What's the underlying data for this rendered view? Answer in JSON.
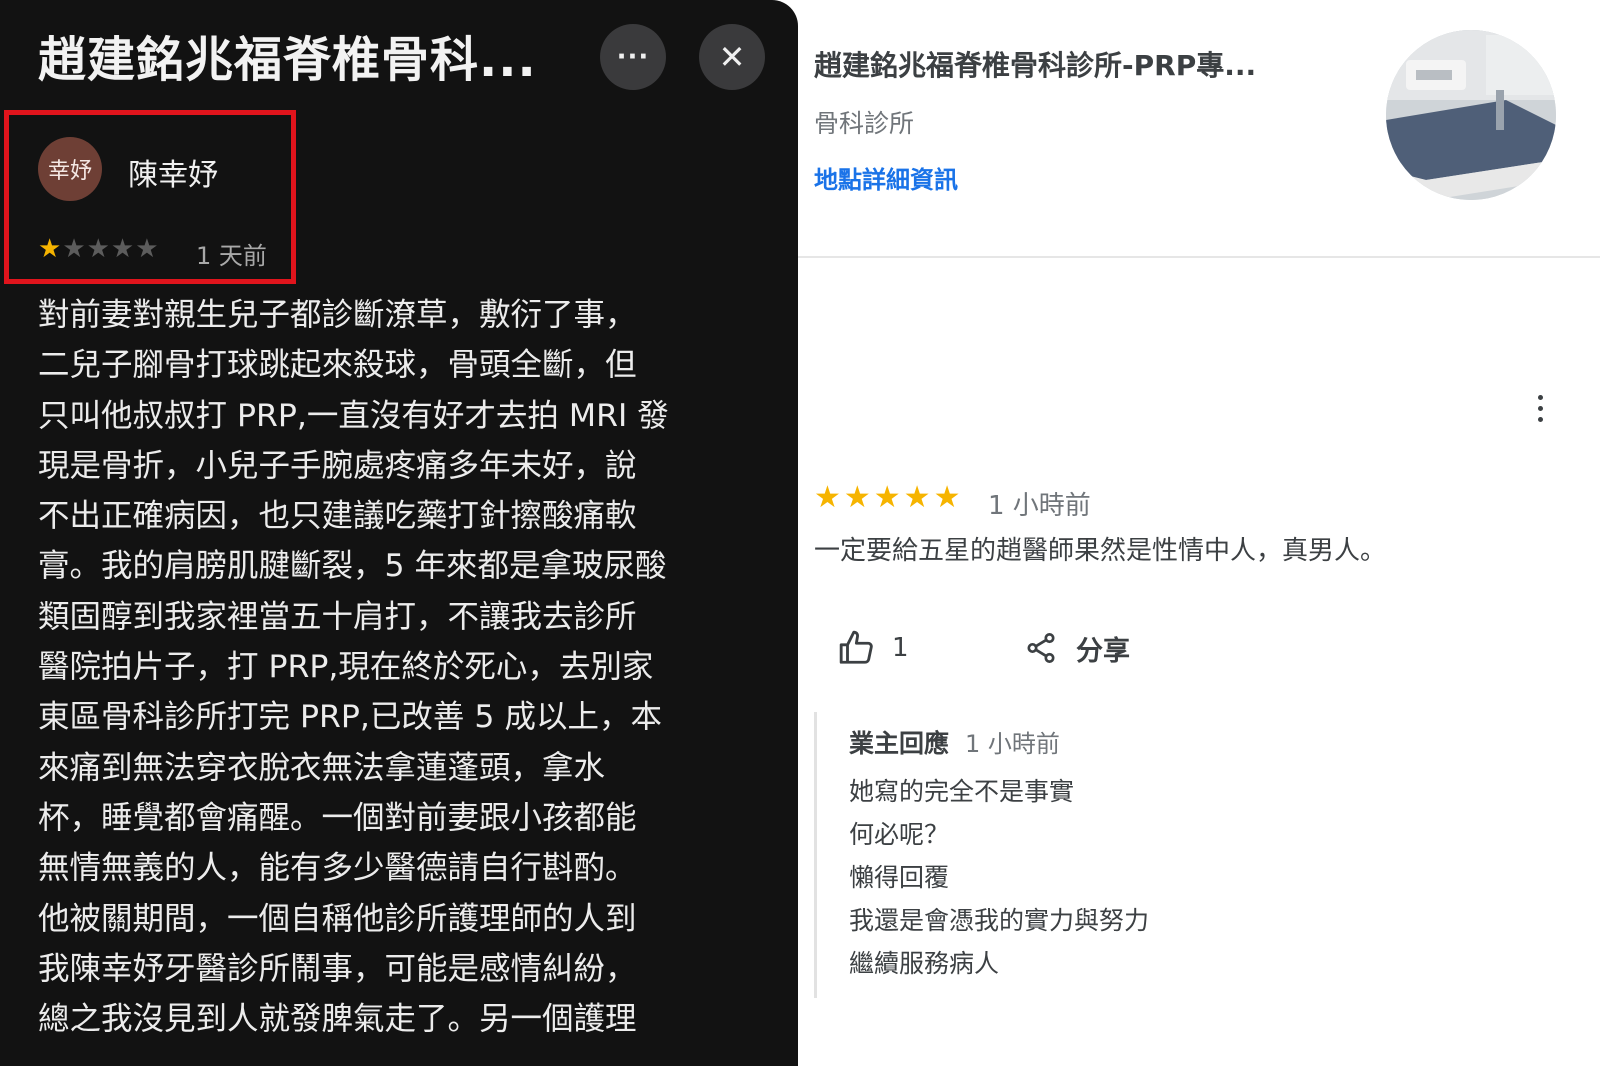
{
  "left_panel": {
    "title": "趙建銘兆福脊椎骨科...",
    "more_icon": "more-horizontal-icon",
    "more_label": "···",
    "close_icon": "close-icon",
    "close_label": "✕",
    "highlight_color": "#e0141c",
    "reviewer": {
      "avatar_text": "幸妤",
      "name": "陳幸妤"
    },
    "rating": 1,
    "rating_max": 5,
    "rating_display": {
      "filled": "★",
      "empty": "★★★★"
    },
    "time": "1 天前",
    "review_lines": [
      "對前妻對親生兒子都診斷潦草，敷衍了事，",
      "二兒子腳骨打球跳起來殺球，骨頭全斷，但",
      "只叫他叔叔打 PRP,一直沒有好才去拍 MRI 發",
      "現是骨折，小兒子手腕處疼痛多年未好，說",
      "不出正確病因，也只建議吃藥打針擦酸痛軟",
      "膏。我的肩膀肌腱斷裂，5 年來都是拿玻尿酸",
      "類固醇到我家裡當五十肩打，不讓我去診所",
      "醫院拍片子，打 PRP,現在終於死心，去別家",
      "東區骨科診所打完 PRP,已改善 5 成以上，本",
      "來痛到無法穿衣脫衣無法拿蓮蓬頭，拿水",
      "杯，睡覺都會痛醒。一個對前妻跟小孩都能",
      "無情無義的人，能有多少醫德請自行斟酌。",
      "他被關期間，一個自稱他診所護理師的人到",
      "我陳幸妤牙醫診所鬧事，可能是感情糾紛，",
      "總之我沒見到人就發脾氣走了。另一個護理"
    ]
  },
  "right_panel": {
    "place_name": "趙建銘兆福脊椎骨科診所-PRP專...",
    "category": "骨科診所",
    "details_link": "地點詳細資訊",
    "photo_icon": "clinic-photo",
    "menu_icon": "more-vertical-icon",
    "review": {
      "rating": 5,
      "rating_max": 5,
      "stars": "★★★★★",
      "time": "1 小時前",
      "text": "一定要給五星的趙醫師果然是性情中人，真男人。",
      "likes": "1",
      "like_icon": "thumbs-up-icon",
      "share_icon": "share-icon",
      "share_label": "分享"
    },
    "owner_reply": {
      "label": "業主回應",
      "time": "1 小時前",
      "lines": [
        "她寫的完全不是事實",
        "何必呢？",
        "懶得回覆",
        "我還是會憑我的實力與努力",
        "繼續服務病人"
      ]
    }
  },
  "colors": {
    "left_bg": "#121212",
    "star": "#f6b400",
    "link": "#1a73e8",
    "highlight_box": "#e0141c"
  }
}
